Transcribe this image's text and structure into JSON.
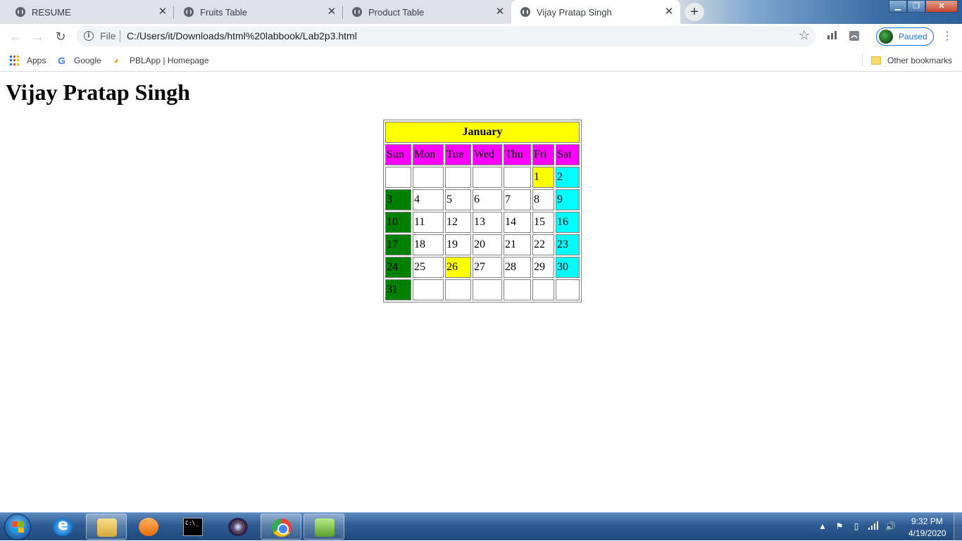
{
  "browser": {
    "tabs": [
      {
        "title": "RESUME",
        "close": "✕"
      },
      {
        "title": "Fruits Table",
        "close": "✕"
      },
      {
        "title": "Product Table",
        "close": "✕"
      },
      {
        "title": "Vijay Pratap Singh",
        "close": "✕",
        "active": true
      }
    ],
    "new_tab": "+",
    "window_controls": {
      "minimize": "▁",
      "maximize": "❐",
      "close": "✕"
    },
    "toolbar": {
      "back": "←",
      "forward": "→",
      "reload": "↻",
      "info_icon": "i",
      "scheme_label": "File",
      "url": "C:/Users/it/Downloads/html%20labbook/Lab2p3.html",
      "star": "☆",
      "profile_status": "Paused",
      "menu": "⋮"
    },
    "bookmarks": [
      {
        "label": "Apps",
        "icon": "apps-grid-icon"
      },
      {
        "label": "Google",
        "icon": "google-icon"
      },
      {
        "label": "PBLApp | Homepage",
        "icon": "pblapp-icon"
      }
    ],
    "other_bookmarks": "Other bookmarks"
  },
  "page": {
    "heading": "Vijay Pratap Singh",
    "calendar": {
      "month": "January",
      "days": [
        "Sun",
        "Mon",
        "Tue",
        "Wed",
        "Thu",
        "Fri",
        "Sat"
      ],
      "weeks": [
        [
          "",
          "",
          "",
          "",
          "",
          "1",
          "2"
        ],
        [
          "3",
          "4",
          "5",
          "6",
          "7",
          "8",
          "9"
        ],
        [
          "10",
          "11",
          "12",
          "13",
          "14",
          "15",
          "16"
        ],
        [
          "17",
          "18",
          "19",
          "20",
          "21",
          "22",
          "23"
        ],
        [
          "24",
          "25",
          "26",
          "27",
          "28",
          "29",
          "30"
        ],
        [
          "31",
          "",
          "",
          "",
          "",
          "",
          ""
        ]
      ],
      "highlighted_dates": [
        "1",
        "26"
      ],
      "colors": {
        "month_header": "#ffff00",
        "day_header": "#ff00ff",
        "sunday": "#008000",
        "saturday": "#00ffff",
        "highlight": "#ffff00"
      }
    }
  },
  "taskbar": {
    "apps": [
      "internet-explorer-icon",
      "windows-explorer-icon",
      "media-player-icon",
      "command-prompt-icon",
      "eclipse-icon",
      "chrome-icon",
      "notepad-plus-plus-icon"
    ],
    "tray_icons": [
      "show-hidden-icons-icon",
      "action-center-flag-icon",
      "power-icon",
      "network-signal-icon",
      "volume-icon"
    ],
    "time": "9:32 PM",
    "date": "4/19/2020"
  }
}
